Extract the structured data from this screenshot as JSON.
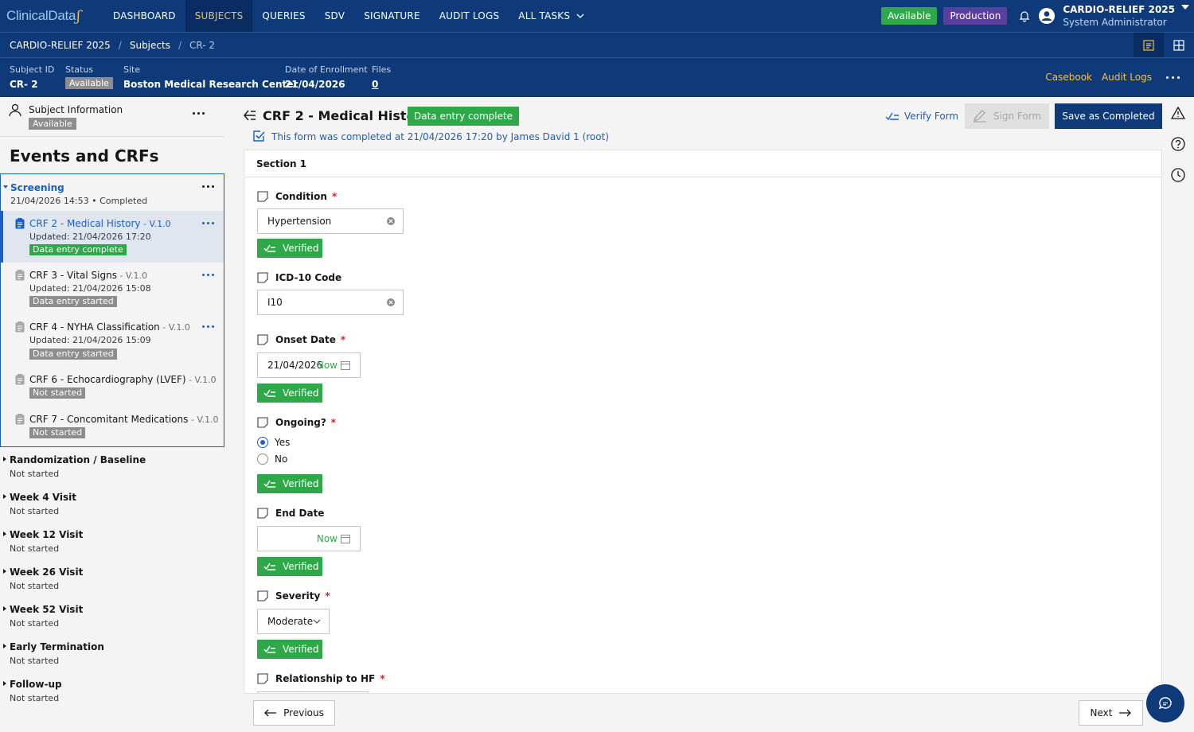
{
  "brand": {
    "logo_text": "ClinicalData",
    "logo_mark": "ʃ"
  },
  "nav": {
    "items": [
      "DASHBOARD",
      "SUBJECTS",
      "QUERIES",
      "SDV",
      "SIGNATURE",
      "AUDIT LOGS",
      "ALL TASKS"
    ],
    "active": "SUBJECTS"
  },
  "topbar": {
    "status_badge": "Available",
    "env_badge": "Production",
    "study_name": "CARDIO-RELIEF 2025",
    "user_role": "System Administrator"
  },
  "breadcrumb": {
    "study": "CARDIO-RELIEF 2025",
    "section": "Subjects",
    "current": "CR- 2"
  },
  "subject_header": {
    "subject_id_label": "Subject ID",
    "subject_id": "CR- 2",
    "status_label": "Status",
    "status": "Available",
    "site_label": "Site",
    "site": "Boston Medical Research Center",
    "enroll_label": "Date of Enrollment",
    "enroll_date": "21/04/2026",
    "files_label": "Files",
    "files": "0",
    "casebook_link": "Casebook",
    "audit_link": "Audit Logs"
  },
  "left_panel": {
    "subject_info_title": "Subject Information",
    "subject_info_status": "Available",
    "events_title": "Events and CRFs",
    "screening": {
      "name": "Screening",
      "meta": "21/04/2026 14:53 • Completed",
      "crfs": [
        {
          "name": "CRF 2 - Medical History",
          "version": " - V.1.0",
          "updated": "Updated: 21/04/2026 17:20",
          "status": "Data entry complete"
        },
        {
          "name": "CRF 3 - Vital Signs",
          "version": " - V.1.0",
          "updated": "Updated: 21/04/2026 15:08",
          "status": "Data entry started"
        },
        {
          "name": "CRF 4 - NYHA Classification",
          "version": " - V.1.0",
          "updated": "Updated: 21/04/2026 15:09",
          "status": "Data entry started"
        },
        {
          "name": "CRF 6 - Echocardiography (LVEF)",
          "version": " - V.1.0",
          "status": "Not started"
        },
        {
          "name": "CRF 7 - Concomitant Medications",
          "version": " - V.1.0",
          "status": "Not started"
        }
      ]
    },
    "events": [
      {
        "name": "Randomization / Baseline",
        "status": "Not started"
      },
      {
        "name": "Week 4 Visit",
        "status": "Not started"
      },
      {
        "name": "Week 12 Visit",
        "status": "Not started"
      },
      {
        "name": "Week 26 Visit",
        "status": "Not started"
      },
      {
        "name": "Week 52 Visit",
        "status": "Not started"
      },
      {
        "name": "Early Termination",
        "status": "Not started"
      },
      {
        "name": "Follow-up",
        "status": "Not started"
      }
    ]
  },
  "form": {
    "title": "CRF 2 - Medical History",
    "status_badge": "Data entry complete",
    "completed_note": "This form was completed at 21/04/2026 17:20 by James David 1 (root)",
    "verify_label": "Verify Form",
    "sign_label": "Sign Form",
    "save_label": "Save as Completed",
    "section_title": "Section 1",
    "verified_label": "Verified",
    "now_label": "Now",
    "required_mark": "*",
    "fields": {
      "condition": {
        "label": "Condition",
        "value": "Hypertension"
      },
      "icd10": {
        "label": "ICD-10 Code",
        "value": "I10"
      },
      "onset": {
        "label": "Onset Date",
        "value": "21/04/2026"
      },
      "ongoing": {
        "label": "Ongoing?",
        "options": [
          "Yes",
          "No"
        ],
        "selected": "Yes"
      },
      "end_date": {
        "label": "End Date",
        "value": ""
      },
      "severity": {
        "label": "Severity",
        "value": "Moderate"
      },
      "relationship": {
        "label": "Relationship to HF"
      }
    }
  },
  "footer": {
    "prev_label": "Previous",
    "next_label": "Next"
  },
  "colors": {
    "nav_bg": "#0f3a7a",
    "accent_yellow": "#f0c24a",
    "success": "#2fa84a",
    "link_blue": "#1a5fc4",
    "env_purple": "#5a3f9e"
  }
}
